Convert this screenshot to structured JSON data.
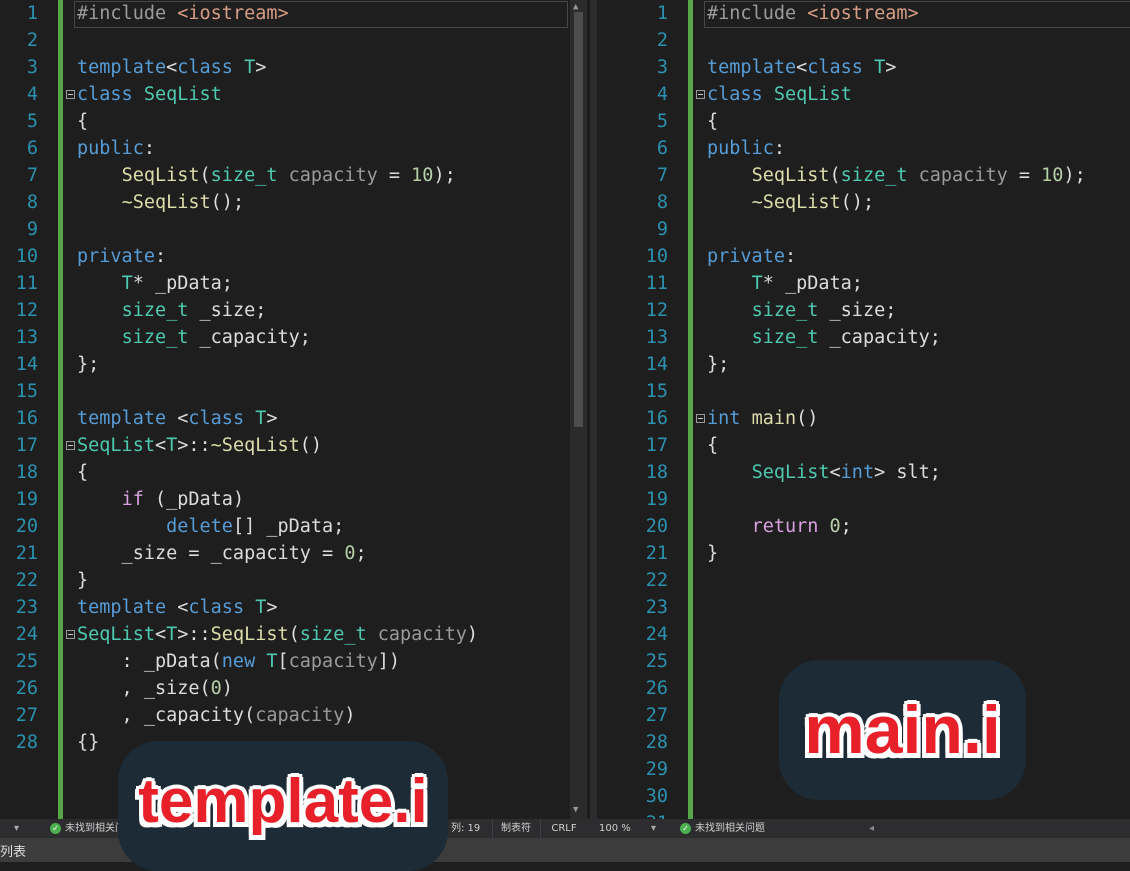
{
  "colors": {
    "keyword": "#569cd6",
    "type": "#4ec9b0",
    "function": "#dcdcaa",
    "parameter": "#9a9a9a",
    "number": "#b5cea8",
    "control": "#d8a0df",
    "line_number": "#2b91af",
    "change_bar": "#57a64a",
    "overlay_text": "#e8202a"
  },
  "left_editor": {
    "line_count": 28,
    "fold_lines": [
      4,
      17,
      24
    ],
    "lines": [
      [
        [
          "#include ",
          "pp"
        ],
        [
          "<iostream>",
          "str"
        ]
      ],
      [],
      [
        [
          "template",
          "kw"
        ],
        [
          "<",
          "tx"
        ],
        [
          "class",
          "kw"
        ],
        [
          " ",
          "tx"
        ],
        [
          "T",
          "ty"
        ],
        [
          ">",
          "tx"
        ]
      ],
      [
        [
          "class",
          "kw"
        ],
        [
          " ",
          "tx"
        ],
        [
          "SeqList",
          "ty"
        ]
      ],
      [
        [
          "{",
          "tx"
        ]
      ],
      [
        [
          "public",
          "kw"
        ],
        [
          ":",
          "tx"
        ]
      ],
      [
        [
          "    ",
          "tx"
        ],
        [
          "SeqList",
          "fn"
        ],
        [
          "(",
          "tx"
        ],
        [
          "size_t",
          "ty"
        ],
        [
          " ",
          "tx"
        ],
        [
          "capacity",
          "pm"
        ],
        [
          " = ",
          "tx"
        ],
        [
          "10",
          "num"
        ],
        [
          ");",
          "tx"
        ]
      ],
      [
        [
          "    ",
          "tx"
        ],
        [
          "~SeqList",
          "fn"
        ],
        [
          "();",
          "tx"
        ]
      ],
      [],
      [
        [
          "private",
          "kw"
        ],
        [
          ":",
          "tx"
        ]
      ],
      [
        [
          "    ",
          "tx"
        ],
        [
          "T",
          "ty"
        ],
        [
          "* _pData;",
          "tx"
        ]
      ],
      [
        [
          "    ",
          "tx"
        ],
        [
          "size_t",
          "ty"
        ],
        [
          " _size;",
          "tx"
        ]
      ],
      [
        [
          "    ",
          "tx"
        ],
        [
          "size_t",
          "ty"
        ],
        [
          " _capacity;",
          "tx"
        ]
      ],
      [
        [
          "};",
          "tx"
        ]
      ],
      [],
      [
        [
          "template",
          "kw"
        ],
        [
          " <",
          "tx"
        ],
        [
          "class",
          "kw"
        ],
        [
          " ",
          "tx"
        ],
        [
          "T",
          "ty"
        ],
        [
          ">",
          "tx"
        ]
      ],
      [
        [
          "SeqList",
          "ty"
        ],
        [
          "<",
          "tx"
        ],
        [
          "T",
          "ty"
        ],
        [
          ">::",
          "tx"
        ],
        [
          "~SeqList",
          "fn"
        ],
        [
          "()",
          "tx"
        ]
      ],
      [
        [
          "{",
          "tx"
        ]
      ],
      [
        [
          "    ",
          "tx"
        ],
        [
          "if",
          "ctl"
        ],
        [
          " (_pData)",
          "tx"
        ]
      ],
      [
        [
          "        ",
          "tx"
        ],
        [
          "delete",
          "kw"
        ],
        [
          "[] _pData;",
          "tx"
        ]
      ],
      [
        [
          "    _size = _capacity = ",
          "tx"
        ],
        [
          "0",
          "num"
        ],
        [
          ";",
          "tx"
        ]
      ],
      [
        [
          "}",
          "tx"
        ]
      ],
      [
        [
          "template",
          "kw"
        ],
        [
          " <",
          "tx"
        ],
        [
          "class",
          "kw"
        ],
        [
          " ",
          "tx"
        ],
        [
          "T",
          "ty"
        ],
        [
          ">",
          "tx"
        ]
      ],
      [
        [
          "SeqList",
          "ty"
        ],
        [
          "<",
          "tx"
        ],
        [
          "T",
          "ty"
        ],
        [
          ">::",
          "tx"
        ],
        [
          "SeqList",
          "fn"
        ],
        [
          "(",
          "tx"
        ],
        [
          "size_t",
          "ty"
        ],
        [
          " ",
          "tx"
        ],
        [
          "capacity",
          "pm"
        ],
        [
          ")",
          "tx"
        ]
      ],
      [
        [
          "    : _pData(",
          "tx"
        ],
        [
          "new",
          "kw"
        ],
        [
          " ",
          "tx"
        ],
        [
          "T",
          "ty"
        ],
        [
          "[",
          "tx"
        ],
        [
          "capacity",
          "pm"
        ],
        [
          "])",
          "tx"
        ]
      ],
      [
        [
          "    , _size(",
          "tx"
        ],
        [
          "0",
          "num"
        ],
        [
          ")",
          "tx"
        ]
      ],
      [
        [
          "    , _capacity(",
          "tx"
        ],
        [
          "capacity",
          "pm"
        ],
        [
          ")",
          "tx"
        ]
      ],
      [
        [
          "{}",
          "tx"
        ]
      ]
    ]
  },
  "right_editor": {
    "line_count": 31,
    "fold_lines": [
      4,
      16
    ],
    "lines": [
      [
        [
          "#include ",
          "pp"
        ],
        [
          "<iostream>",
          "str"
        ]
      ],
      [],
      [
        [
          "template",
          "kw"
        ],
        [
          "<",
          "tx"
        ],
        [
          "class",
          "kw"
        ],
        [
          " ",
          "tx"
        ],
        [
          "T",
          "ty"
        ],
        [
          ">",
          "tx"
        ]
      ],
      [
        [
          "class",
          "kw"
        ],
        [
          " ",
          "tx"
        ],
        [
          "SeqList",
          "ty"
        ]
      ],
      [
        [
          "{",
          "tx"
        ]
      ],
      [
        [
          "public",
          "kw"
        ],
        [
          ":",
          "tx"
        ]
      ],
      [
        [
          "    ",
          "tx"
        ],
        [
          "SeqList",
          "fn"
        ],
        [
          "(",
          "tx"
        ],
        [
          "size_t",
          "ty"
        ],
        [
          " ",
          "tx"
        ],
        [
          "capacity",
          "pm"
        ],
        [
          " = ",
          "tx"
        ],
        [
          "10",
          "num"
        ],
        [
          ");",
          "tx"
        ]
      ],
      [
        [
          "    ",
          "tx"
        ],
        [
          "~SeqList",
          "fn"
        ],
        [
          "();",
          "tx"
        ]
      ],
      [],
      [
        [
          "private",
          "kw"
        ],
        [
          ":",
          "tx"
        ]
      ],
      [
        [
          "    ",
          "tx"
        ],
        [
          "T",
          "ty"
        ],
        [
          "* _pData;",
          "tx"
        ]
      ],
      [
        [
          "    ",
          "tx"
        ],
        [
          "size_t",
          "ty"
        ],
        [
          " _size;",
          "tx"
        ]
      ],
      [
        [
          "    ",
          "tx"
        ],
        [
          "size_t",
          "ty"
        ],
        [
          " _capacity;",
          "tx"
        ]
      ],
      [
        [
          "};",
          "tx"
        ]
      ],
      [],
      [
        [
          "int",
          "kw"
        ],
        [
          " ",
          "tx"
        ],
        [
          "main",
          "fn"
        ],
        [
          "()",
          "tx"
        ]
      ],
      [
        [
          "{",
          "tx"
        ]
      ],
      [
        [
          "    ",
          "tx"
        ],
        [
          "SeqList",
          "ty"
        ],
        [
          "<",
          "tx"
        ],
        [
          "int",
          "kw"
        ],
        [
          "> slt;",
          "tx"
        ]
      ],
      [],
      [
        [
          "    ",
          "tx"
        ],
        [
          "return",
          "ctl"
        ],
        [
          " ",
          "tx"
        ],
        [
          "0",
          "num"
        ],
        [
          ";",
          "tx"
        ]
      ],
      [
        [
          "}",
          "tx"
        ]
      ]
    ]
  },
  "left_status": {
    "issues": "未找到相关问题",
    "column": "列: 19",
    "indent": "制表符",
    "line_ending": "CRLF"
  },
  "right_status": {
    "zoom": "100 %",
    "issues": "未找到相关问题"
  },
  "bottom_panel": {
    "label": "列表"
  },
  "overlays": {
    "left_label": "template.i",
    "right_label": "main.i"
  }
}
